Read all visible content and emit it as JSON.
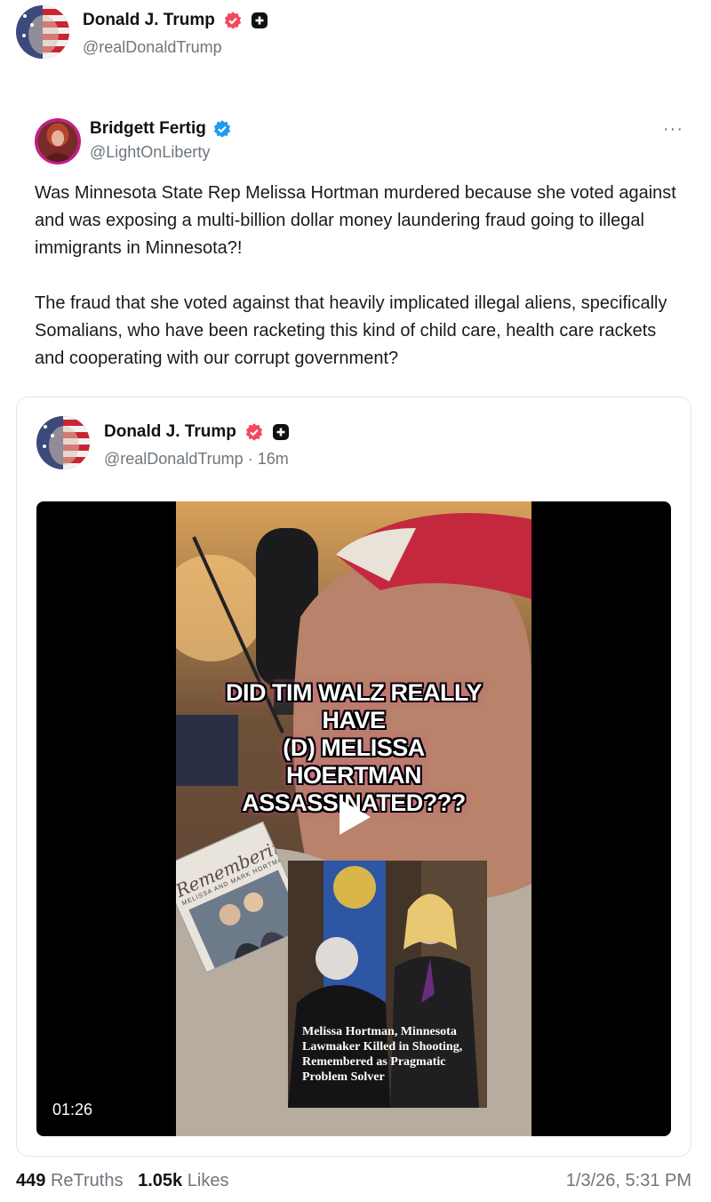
{
  "header": {
    "author_name": "Donald J. Trump",
    "author_handle": "@realDonaldTrump",
    "avatar": "flag-face-avatar",
    "verified_badge_color": "#f4475e"
  },
  "retruth": {
    "author_name": "Bridgett Fertig",
    "author_handle": "@LightOnLiberty",
    "verified_badge_color": "#1d9bf0",
    "more_label": "···",
    "paragraphs": [
      "Was Minnesota State Rep Melissa Hortman murdered because she voted against and was exposing a multi-billion dollar money laundering fraud going to illegal immigrants in Minnesota?!",
      "The fraud that she voted against that heavily implicated illegal aliens, specifically Somalians, who have been racketing this kind of child care, health care rackets and cooperating with our corrupt government?"
    ]
  },
  "quote": {
    "author_name": "Donald J. Trump",
    "author_handle": "@realDonaldTrump",
    "separator": "·",
    "time_ago": "16m",
    "video": {
      "duration": "01:26",
      "headline_lines": [
        "DID TIM WALZ REALLY",
        "HAVE",
        "(D) MELISSA",
        "HOERTMAN",
        "ASSASSINATED???"
      ],
      "book_title": "Remembering",
      "book_subtitle": "MELISSA AND MARK HORTMAN",
      "inset_caption_lines": [
        "Melissa Hortman, Minnesota",
        "Lawmaker Killed in Shooting,",
        "Remembered as Pragmatic",
        "Problem Solver"
      ]
    }
  },
  "footer": {
    "retruths_count": "449",
    "retruths_label": "ReTruths",
    "likes_count": "1.05k",
    "likes_label": "Likes",
    "timestamp": "1/3/26, 5:31 PM"
  },
  "colors": {
    "text": "#0f1419",
    "muted": "#6e767d",
    "truth_badge": "#f4475e",
    "blue_badge": "#1d9bf0"
  }
}
